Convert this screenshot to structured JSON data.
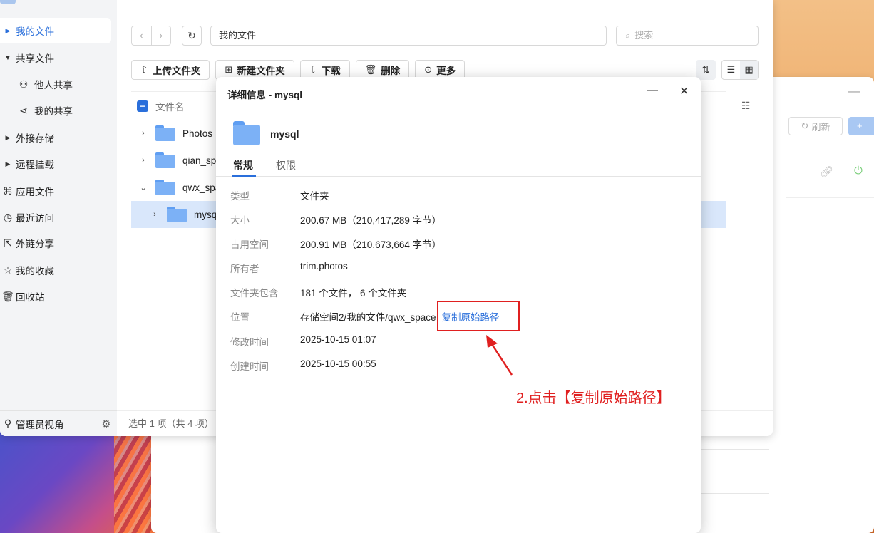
{
  "sidebar": {
    "items": [
      {
        "label": "我的文件",
        "icon": "caret-right-icon",
        "active": true
      },
      {
        "label": "共享文件",
        "icon": "caret-down-icon"
      },
      {
        "label": "他人共享",
        "icon": "users-icon"
      },
      {
        "label": "我的共享",
        "icon": "share-icon"
      },
      {
        "label": "外接存储",
        "icon": "caret-right-icon"
      },
      {
        "label": "远程挂载",
        "icon": "caret-right-icon"
      },
      {
        "label": "应用文件",
        "icon": "command-icon"
      },
      {
        "label": "最近访问",
        "icon": "clock-icon"
      },
      {
        "label": "外链分享",
        "icon": "external-link-icon"
      },
      {
        "label": "我的收藏",
        "icon": "star-icon"
      },
      {
        "label": "回收站",
        "icon": "trash-icon"
      }
    ],
    "footer": {
      "label": "管理员视角"
    }
  },
  "toolbar": {
    "path": "我的文件",
    "search_placeholder": "搜索",
    "upload_label": "上传文件夹",
    "new_folder_label": "新建文件夹",
    "download_label": "下载",
    "delete_label": "删除",
    "more_label": "更多"
  },
  "list": {
    "header": "文件名",
    "rows": [
      {
        "name": "Photos"
      },
      {
        "name": "qian_spa"
      },
      {
        "name": "qwx_spa"
      },
      {
        "name": "mysq"
      }
    ],
    "status": "选中 1 项（共 4 项）"
  },
  "background_window": {
    "refresh_label": "刷新",
    "add_label": "+ "
  },
  "dialog": {
    "title": "详细信息 - mysql",
    "name": "mysql",
    "tabs": [
      "常规",
      "权限"
    ],
    "properties": [
      {
        "key": "类型",
        "value": "文件夹"
      },
      {
        "key": "大小",
        "value": "200.67 MB（210,417,289 字节）"
      },
      {
        "key": "占用空间",
        "value": "200.91 MB（210,673,664 字节）"
      },
      {
        "key": "所有者",
        "value": "trim.photos"
      },
      {
        "key": "文件夹包含",
        "value": "181 个文件， 6 个文件夹"
      },
      {
        "key": "位置",
        "value": "存储空间2/我的文件/qwx_space"
      },
      {
        "key": "修改时间",
        "value": "2025-10-15 01:07"
      },
      {
        "key": "创建时间",
        "value": "2025-10-15 00:55"
      }
    ],
    "copy_path_label": "复制原始路径"
  },
  "annotation": {
    "text": "2.点击【复制原始路径】",
    "color": "#e02020"
  }
}
